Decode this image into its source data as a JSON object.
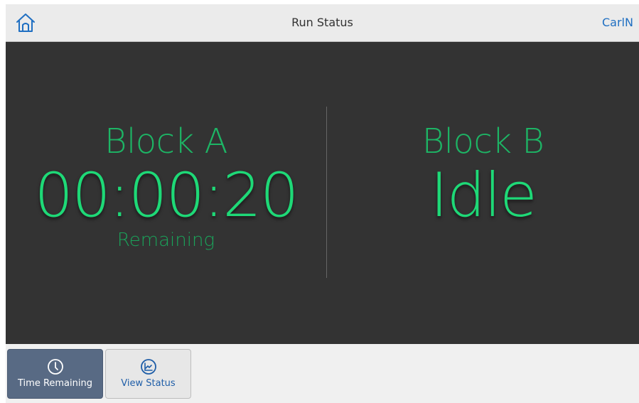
{
  "header": {
    "title": "Run Status",
    "user_label": "CarlN"
  },
  "blocks": [
    {
      "name": "Block A",
      "value": "00:00:20",
      "sub": "Remaining"
    },
    {
      "name": "Block B",
      "value": "Idle",
      "sub": ""
    }
  ],
  "tabs": [
    {
      "label": "Time Remaining",
      "icon": "clock-icon",
      "active": true
    },
    {
      "label": "View Status",
      "icon": "chart-icon",
      "active": false
    }
  ],
  "colors": {
    "accent_green": "#1ed977",
    "panel_bg": "#333333",
    "link_blue": "#1f6fc2",
    "active_tab": "#586a84"
  }
}
